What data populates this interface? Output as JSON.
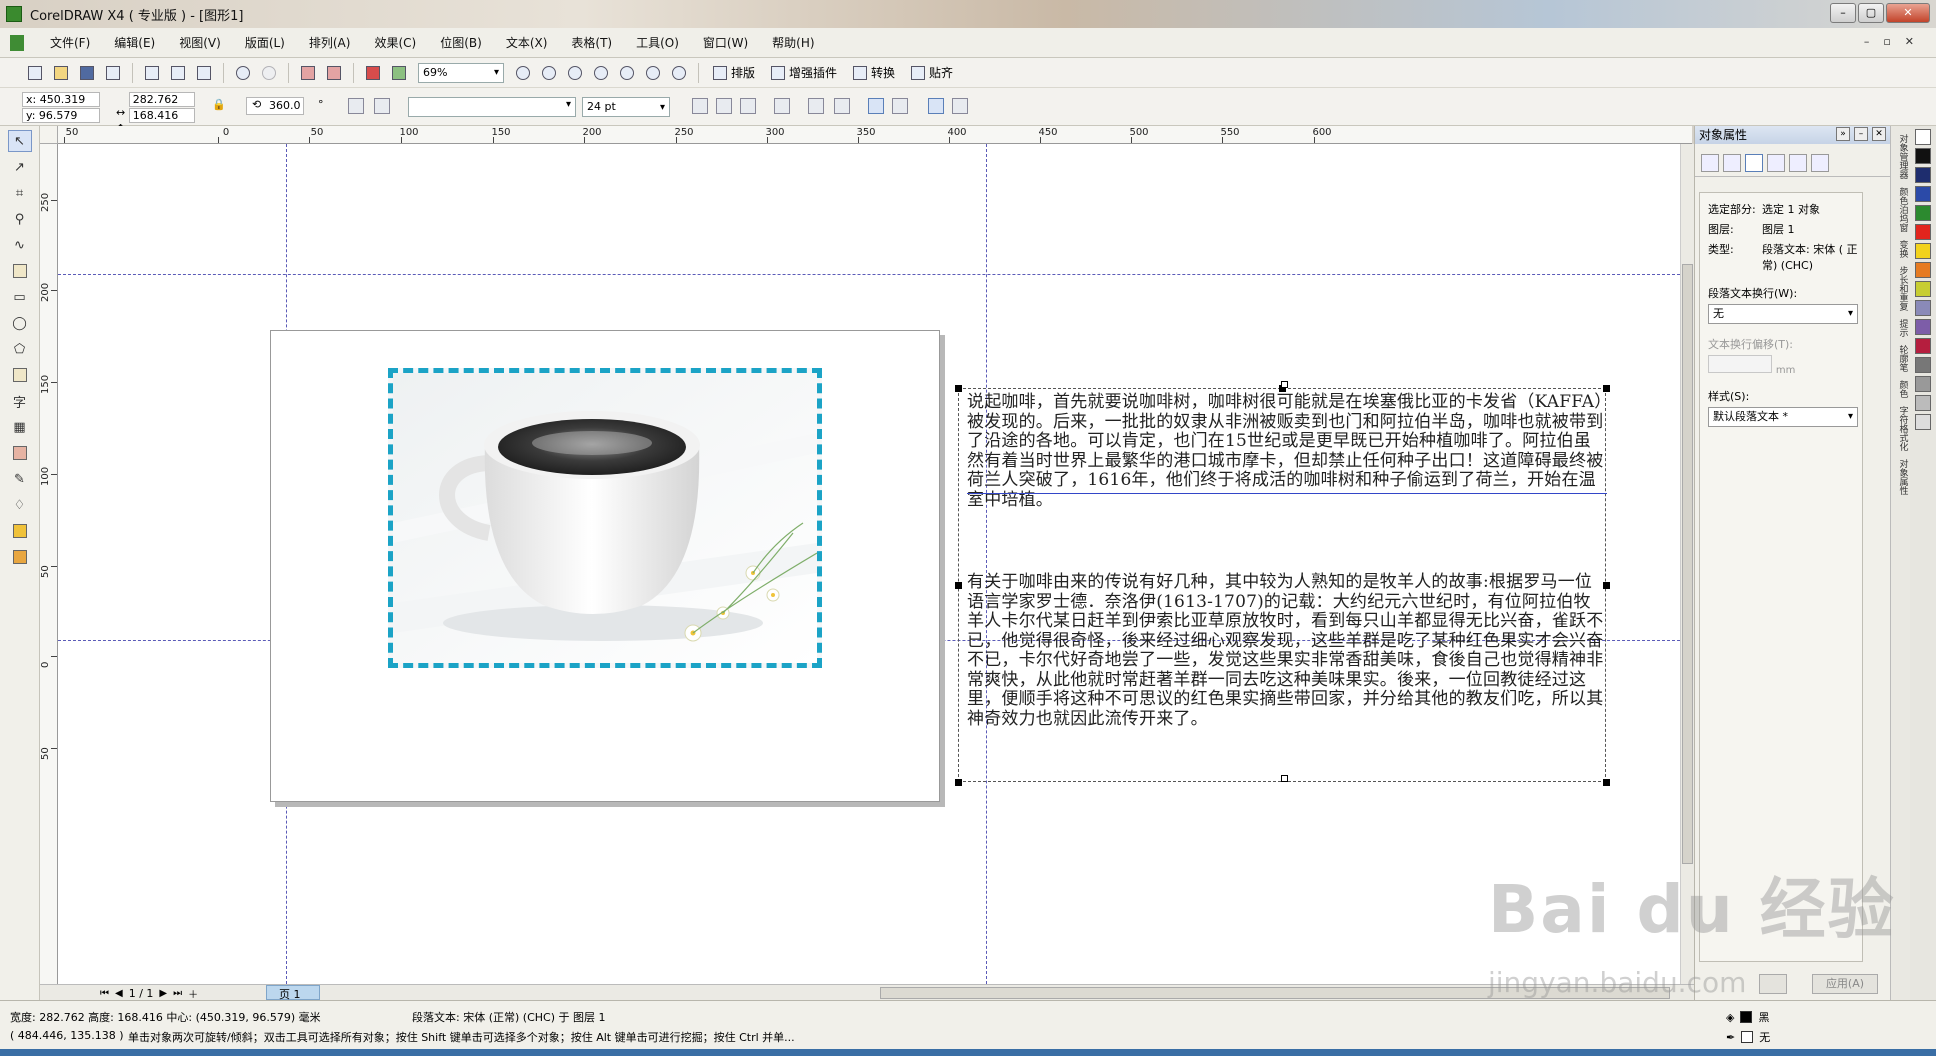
{
  "window": {
    "title": "CorelDRAW X4 ( 专业版 ) - [图形1]"
  },
  "menu": [
    "文件(F)",
    "编辑(E)",
    "视图(V)",
    "版面(L)",
    "排列(A)",
    "效果(C)",
    "位图(B)",
    "文本(X)",
    "表格(T)",
    "工具(O)",
    "窗口(W)",
    "帮助(H)"
  ],
  "toolbar": {
    "zoom": "69%",
    "layout": "排版",
    "plugins": "增强插件",
    "convert": "转换",
    "snap": "贴齐"
  },
  "propbar": {
    "x": "x: 450.319 mm",
    "y": "y: 96.579 mm",
    "w": "282.762 mm",
    "h": "168.416 mm",
    "rotation": "360.0",
    "degree": "°",
    "font_size": "24 pt"
  },
  "ruler": {
    "h": [
      "50",
      "0",
      "50",
      "100",
      "150",
      "200",
      "250",
      "300",
      "350",
      "400",
      "450",
      "500",
      "550",
      "600"
    ],
    "v": [
      "250",
      "200",
      "150",
      "100",
      "50",
      "0",
      "50"
    ],
    "unit": "毫米"
  },
  "text": {
    "para1": "说起咖啡，首先就要说咖啡树，咖啡树很可能就是在埃塞俄比亚的卡发省（KAFFA）被发现的。后来，一批批的奴隶从非洲被贩卖到也门和阿拉伯半岛，咖啡也就被带到了沿途的各地。可以肯定，也门在15世纪或是更早既已开始种植咖啡了。阿拉伯虽然有着当时世界上最繁华的港口城市摩卡，但却禁止任何种子出口！这道障碍最终被荷兰人突破了，1616年，他们终于将成活的咖啡树和种子偷运到了荷兰，开始在温室中培植。",
    "para2": "有关于咖啡由来的传说有好几种，其中较为人熟知的是牧羊人的故事:根据罗马一位语言学家罗士德．奈洛伊(1613-1707)的记载：大约纪元六世纪时，有位阿拉伯牧羊人卡尔代某日赶羊到伊索比亚草原放牧时，看到每只山羊都显得无比兴奋，雀跃不已，他觉得很奇怪，後来经过细心观察发现，这些羊群是吃了某种红色果实才会兴奋不已，卡尔代好奇地尝了一些，发觉这些果实非常香甜美味，食後自己也觉得精神非常爽快，从此他就时常赶著羊群一同去吃这种美味果实。後来，一位回教徒经过这里，便顺手将这种不可思议的红色果实摘些带回家，并分给其他的教友们吃，所以其神奇效力也就因此流传开来了。"
  },
  "pagenav": {
    "count": "1 / 1",
    "tab": "页 1"
  },
  "docker": {
    "title": "对象属性",
    "selection_label": "选定部分:",
    "selection_value": "选定 1 对象",
    "layer_label": "图层:",
    "layer_value": "图层 1",
    "type_label": "类型:",
    "type_value": "段落文本: 宋体 ( 正常) (CHC)",
    "wrap_label": "段落文本换行(W):",
    "wrap_value": "无",
    "offset_label": "文本换行偏移(T):",
    "offset_unit": "mm",
    "style_label": "样式(S):",
    "style_value": "默认段落文本 *",
    "apply": "应用(A)"
  },
  "sidetabs": [
    "对象管理器",
    "颜色泊坞窗",
    "变换",
    "步长和重复",
    "提示",
    "轮廓笔",
    "颜色",
    "字符格式化",
    "对象属性"
  ],
  "palette": [
    "#ffffff",
    "#111111",
    "#1e2d6e",
    "#2b4aa8",
    "#2c8a2f",
    "#e2241d",
    "#f2d21c",
    "#e67b22",
    "#c7cd32",
    "#8a8ab8",
    "#7d5da8",
    "#b51e3e",
    "#777777",
    "#999999",
    "#bbbbbb",
    "#dddddd"
  ],
  "status": {
    "dims": "宽度: 282.762  高度: 168.416  中心: (450.319, 96.579)  毫米",
    "obj": "段落文本: 宋体 (正常) (CHC) 于 图层 1",
    "cursor": "( 484.446, 135.138 )",
    "hint": "单击对象两次可旋转/倾斜；双击工具可选择所有对象；按住 Shift 键单击可选择多个对象；按住 Alt 键单击可进行挖掘；按住 Ctrl 并单...",
    "fill": "黑",
    "outline": "无"
  },
  "watermark": {
    "main": "Bai du 经验",
    "url": "jingyan.baidu.com"
  },
  "colors": {
    "accent": "#1ba3c6",
    "guide": "#5b5bb8"
  }
}
